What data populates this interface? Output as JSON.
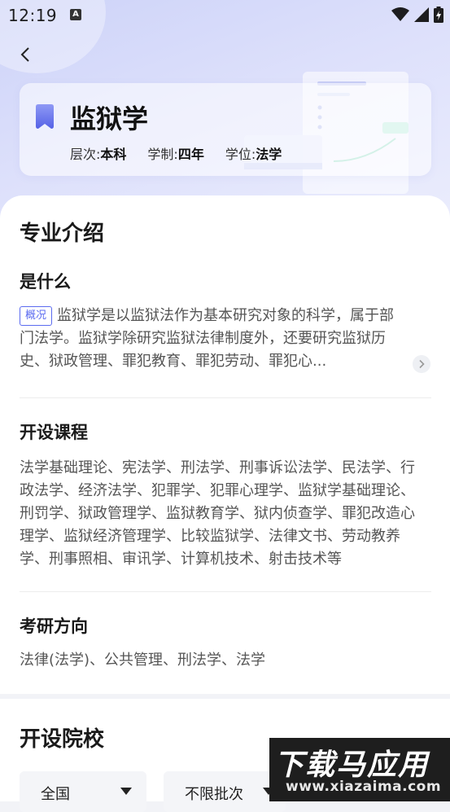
{
  "status_bar": {
    "time": "12:19",
    "notification_icon": "A"
  },
  "header": {
    "major_name": "监狱学",
    "level_label": "层次:",
    "level_value": "本科",
    "duration_label": "学制:",
    "duration_value": "四年",
    "degree_label": "学位:",
    "degree_value": "法学"
  },
  "intro": {
    "title": "专业介绍",
    "what_title": "是什么",
    "tag": "概况",
    "description": "监狱学是以监狱法作为基本研究对象的科学，属于部门法学。监狱学除研究监狱法律制度外，还要研究监狱历史、狱政管理、罪犯教育、罪犯劳动、罪犯心..."
  },
  "courses": {
    "title": "开设课程",
    "text": "法学基础理论、宪法学、刑法学、刑事诉讼法学、民法学、行政法学、经济法学、犯罪学、犯罪心理学、监狱学基础理论、刑罚学、狱政管理学、监狱教育学、狱内侦查学、罪犯改造心理学、监狱经济管理学、比较监狱学、法律文书、劳动教养学、刑事照相、审讯学、计算机技术、射击技术等"
  },
  "postgrad": {
    "title": "考研方向",
    "text": "法律(法学)、公共管理、刑法学、法学"
  },
  "schools": {
    "title": "开设院校",
    "filter_region": "全国",
    "filter_batch": "不限批次"
  },
  "watermark": {
    "big": "下载马应用",
    "small": "www.xiazaima.com"
  },
  "colors": {
    "accent": "#5b6bf0",
    "header_bg": "#d6dafa"
  }
}
